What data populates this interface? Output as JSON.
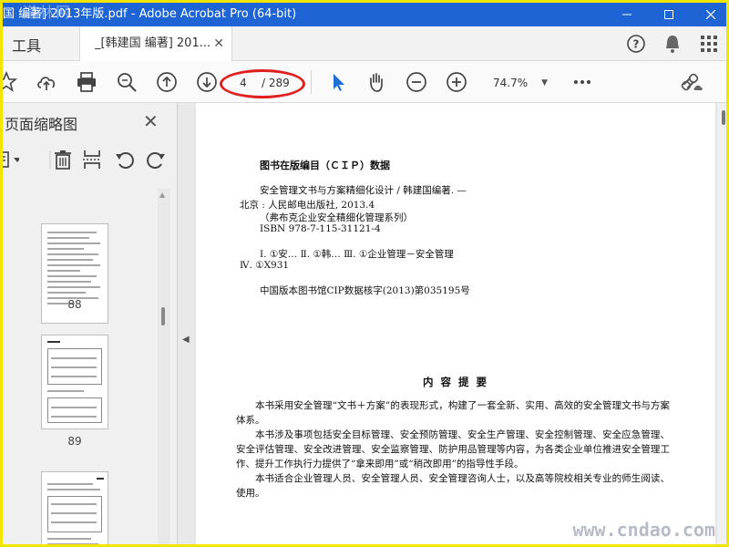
{
  "window": {
    "title": "国 编著] 2013年版.pdf - Adobe Acrobat Pro (64-bit)",
    "logo_watermark": "道林网"
  },
  "tabs": {
    "tools_label": "工具",
    "doc_label": "_[韩建国 编著] 201..."
  },
  "toolbar": {
    "page_current": "4",
    "page_total": "/ 289",
    "zoom": "74.7%"
  },
  "sidebar": {
    "title": "页面缩略图",
    "thumbnails": [
      {
        "label": "88"
      },
      {
        "label": "89"
      },
      {
        "label": ""
      }
    ]
  },
  "document": {
    "cip_title": "图书在版编目（ＣＩＰ）数据",
    "cip_lines": [
      "安全管理文书与方案精细化设计 / 韩建国编著. —",
      "北京 : 人民邮电出版社, 2013.4",
      "（弗布克企业安全精细化管理系列）",
      "ISBN 978-7-115-31121-4",
      "Ⅰ. ①安… Ⅱ. ①韩… Ⅲ. ①企业管理－安全管理",
      "Ⅳ. ①X931",
      "中国版本图书馆CIP数据核字(2013)第035195号"
    ],
    "intro_title": "内 容 提 要",
    "paragraphs": [
      "本书采用安全管理“文书＋方案”的表现形式，构建了一套全新、实用、高效的安全管理文书与方案体系。",
      "本书涉及事项包括安全目标管理、安全预防管理、安全生产管理、安全控制管理、安全应急管理、安全评估管理、安全改进管理、安全监察管理、防护用品管理等内容，为各类企业单位推进安全管理工作、提升工作执行力提供了“拿来即用”或“稍改即用”的指导性手段。",
      "本书适合企业管理人员、安全管理人员、安全管理咨询人士，以及高等院校相关专业的师生阅读、使用。"
    ]
  },
  "site_watermark": "www.cndao.com",
  "colors": {
    "titlebar": "#1e64d4",
    "frame": "#f2e600",
    "annotation_oval": "#e02020",
    "select_tool": "#1f6fd6"
  }
}
